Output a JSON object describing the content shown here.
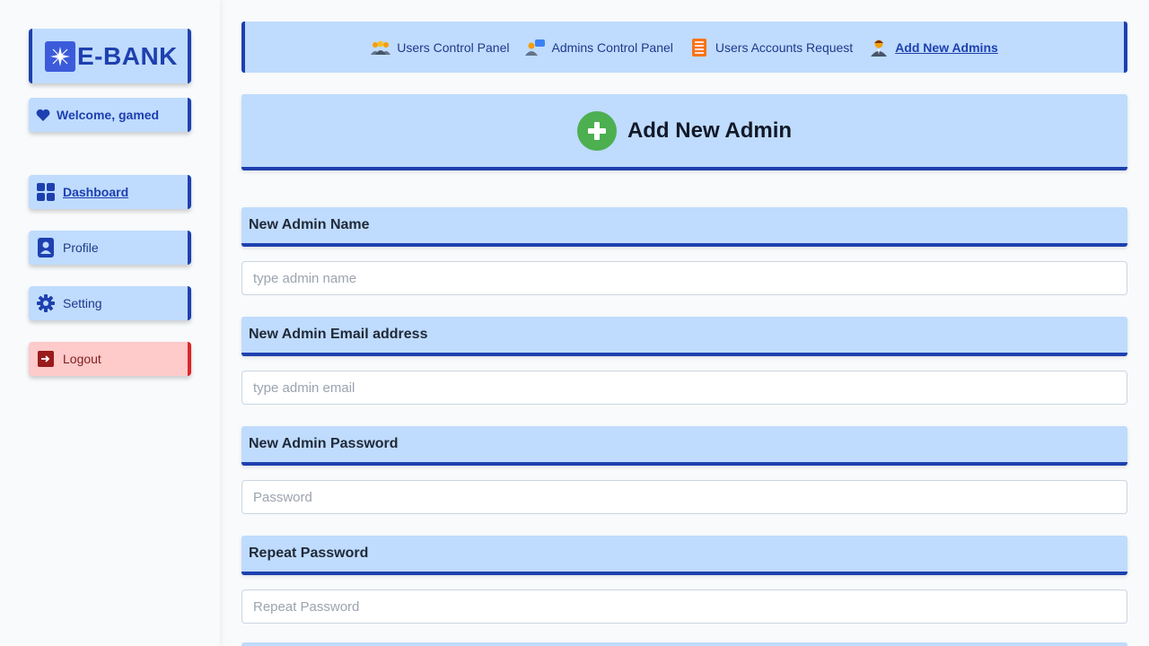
{
  "brand": {
    "name": "E-BANK",
    "logo_icon": "sparkle-icon"
  },
  "sidebar": {
    "welcome": "Welcome, gamed",
    "items": [
      {
        "label": "Dashboard",
        "icon": "dashboard-icon",
        "active": true
      },
      {
        "label": "Profile",
        "icon": "profile-icon"
      },
      {
        "label": "Setting",
        "icon": "gear-icon"
      },
      {
        "label": "Logout",
        "icon": "logout-icon",
        "color": "#dc2626"
      }
    ]
  },
  "topnav": {
    "items": [
      {
        "label": "Users Control Panel",
        "icon": "users-group-icon"
      },
      {
        "label": "Admins Control Panel",
        "icon": "admins-icon"
      },
      {
        "label": "Users Accounts Request",
        "icon": "accounts-request-icon"
      },
      {
        "label": "Add New Admins",
        "icon": "admin-person-icon",
        "active": true
      }
    ]
  },
  "page": {
    "title": "Add New Admin",
    "title_icon": "plus-circle-icon"
  },
  "form": {
    "name": {
      "label": "New Admin Name",
      "placeholder": "type admin name"
    },
    "email": {
      "label": "New Admin Email address",
      "placeholder": "type admin email"
    },
    "password": {
      "label": "New Admin Password",
      "placeholder": "Password"
    },
    "repeat": {
      "label": "Repeat Password",
      "placeholder": "Repeat Password"
    }
  },
  "colors": {
    "accent": "#1e40af",
    "panel": "#bfdbfe",
    "logout_bg": "#fecaca",
    "logout_accent": "#dc2626",
    "success": "#4caf50"
  }
}
